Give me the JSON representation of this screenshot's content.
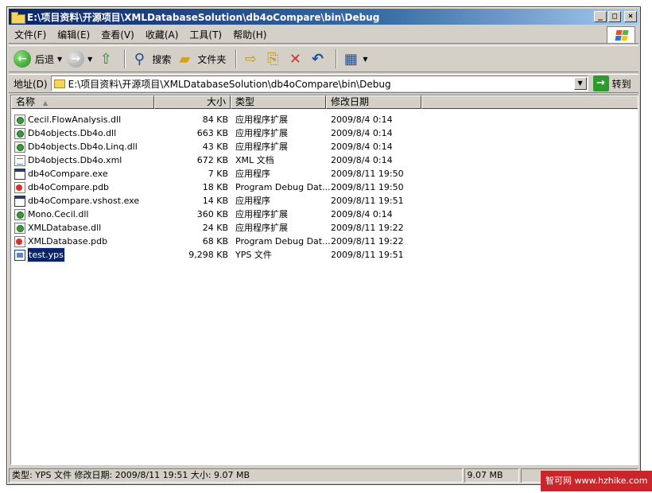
{
  "window": {
    "title": "E:\\项目资料\\开源项目\\XMLDatabaseSolution\\db4oCompare\\bin\\Debug"
  },
  "menu": [
    "文件(F)",
    "编辑(E)",
    "查看(V)",
    "收藏(A)",
    "工具(T)",
    "帮助(H)"
  ],
  "toolbar": {
    "back_label": "后退",
    "search_label": "搜索",
    "folders_label": "文件夹"
  },
  "address": {
    "label": "地址(D)",
    "path": "E:\\项目资料\\开源项目\\XMLDatabaseSolution\\db4oCompare\\bin\\Debug",
    "go_label": "转到"
  },
  "columns": {
    "name": "名称",
    "size": "大小",
    "type": "类型",
    "date": "修改日期"
  },
  "files": [
    {
      "name": "Cecil.FlowAnalysis.dll",
      "size": "84 KB",
      "type": "应用程序扩展",
      "date": "2009/8/4 0:14",
      "icon": "dll"
    },
    {
      "name": "Db4objects.Db4o.dll",
      "size": "663 KB",
      "type": "应用程序扩展",
      "date": "2009/8/4 0:14",
      "icon": "dll"
    },
    {
      "name": "Db4objects.Db4o.Linq.dll",
      "size": "43 KB",
      "type": "应用程序扩展",
      "date": "2009/8/4 0:14",
      "icon": "dll"
    },
    {
      "name": "Db4objects.Db4o.xml",
      "size": "672 KB",
      "type": "XML 文档",
      "date": "2009/8/4 0:14",
      "icon": "xml"
    },
    {
      "name": "db4oCompare.exe",
      "size": "7 KB",
      "type": "应用程序",
      "date": "2009/8/11 19:50",
      "icon": "exe"
    },
    {
      "name": "db4oCompare.pdb",
      "size": "18 KB",
      "type": "Program Debug Dat...",
      "date": "2009/8/11 19:50",
      "icon": "pdb"
    },
    {
      "name": "db4oCompare.vshost.exe",
      "size": "14 KB",
      "type": "应用程序",
      "date": "2009/8/11 19:51",
      "icon": "exe"
    },
    {
      "name": "Mono.Cecil.dll",
      "size": "360 KB",
      "type": "应用程序扩展",
      "date": "2009/8/4 0:14",
      "icon": "dll"
    },
    {
      "name": "XMLDatabase.dll",
      "size": "24 KB",
      "type": "应用程序扩展",
      "date": "2009/8/11 19:22",
      "icon": "dll"
    },
    {
      "name": "XMLDatabase.pdb",
      "size": "68 KB",
      "type": "Program Debug Dat...",
      "date": "2009/8/11 19:22",
      "icon": "pdb"
    },
    {
      "name": "test.yps",
      "size": "9,298 KB",
      "type": "YPS 文件",
      "date": "2009/8/11 19:51",
      "icon": "yps",
      "selected": true
    }
  ],
  "status": {
    "info": "类型: YPS 文件 修改日期: 2009/8/11 19:51 大小: 9.07 MB",
    "size": "9.07 MB"
  },
  "watermark": "智可网 www.hzhike.com"
}
